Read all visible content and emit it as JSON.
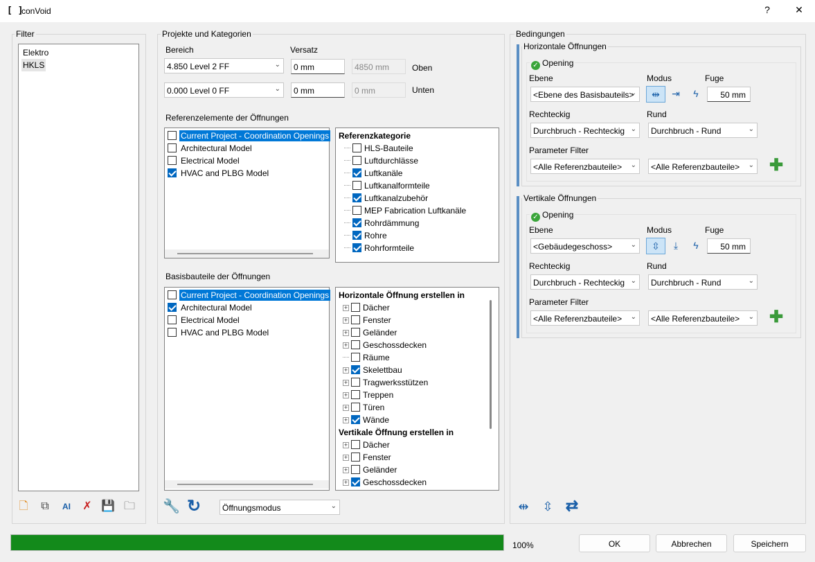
{
  "window": {
    "icon": "[ ]",
    "title": "conVoid",
    "help": "?",
    "close": "✕"
  },
  "filter": {
    "label": "Filter",
    "items": [
      "Elektro",
      "HKLS"
    ]
  },
  "projekte": {
    "label": "Projekte und Kategorien",
    "bereich_label": "Bereich",
    "versatz_label": "Versatz",
    "oben": {
      "level": "4.850  Level 2 FF",
      "offset": "0 mm",
      "computed": "4850 mm",
      "label": "Oben"
    },
    "unten": {
      "level": "0.000  Level 0 FF",
      "offset": "0 mm",
      "computed": "0 mm",
      "label": "Unten"
    },
    "ref_label": "Referenzelemente der Öffnungen",
    "ref_models": [
      {
        "label": "Current Project - Coordination Openings",
        "checked": false,
        "selected": true
      },
      {
        "label": "Architectural Model",
        "checked": false,
        "selected": false
      },
      {
        "label": "Electrical Model",
        "checked": false,
        "selected": false
      },
      {
        "label": "HVAC and PLBG Model",
        "checked": true,
        "selected": false
      }
    ],
    "ref_cat_header": "Referenzkategorie",
    "ref_cats": [
      {
        "label": "HLS-Bauteile",
        "checked": false
      },
      {
        "label": "Luftdurchlässe",
        "checked": false
      },
      {
        "label": "Luftkanäle",
        "checked": true
      },
      {
        "label": "Luftkanalformteile",
        "checked": false
      },
      {
        "label": "Luftkanalzubehör",
        "checked": true
      },
      {
        "label": "MEP Fabrication Luftkanäle",
        "checked": false
      },
      {
        "label": "Rohrdämmung",
        "checked": true
      },
      {
        "label": "Rohre",
        "checked": true
      },
      {
        "label": "Rohrformteile",
        "checked": true
      }
    ],
    "basis_label": "Basisbauteile der Öffnungen",
    "basis_models": [
      {
        "label": "Current Project - Coordination Openings",
        "checked": false,
        "selected": true
      },
      {
        "label": "Architectural Model",
        "checked": true,
        "selected": false
      },
      {
        "label": "Electrical Model",
        "checked": false,
        "selected": false
      },
      {
        "label": "HVAC and PLBG Model",
        "checked": false,
        "selected": false
      }
    ],
    "h_header": "Horizontale Öffnung erstellen in",
    "h_cats": [
      {
        "label": "Dächer",
        "checked": false,
        "plus": true
      },
      {
        "label": "Fenster",
        "checked": false,
        "plus": true
      },
      {
        "label": "Geländer",
        "checked": false,
        "plus": true
      },
      {
        "label": "Geschossdecken",
        "checked": false,
        "plus": true
      },
      {
        "label": "Räume",
        "checked": false,
        "plus": false
      },
      {
        "label": "Skelettbau",
        "checked": true,
        "plus": true
      },
      {
        "label": "Tragwerksstützen",
        "checked": false,
        "plus": true
      },
      {
        "label": "Treppen",
        "checked": false,
        "plus": true
      },
      {
        "label": "Türen",
        "checked": false,
        "plus": true
      },
      {
        "label": "Wände",
        "checked": true,
        "plus": true
      }
    ],
    "v_header": "Vertikale Öffnung erstellen in",
    "v_cats": [
      {
        "label": "Dächer",
        "checked": false,
        "plus": true
      },
      {
        "label": "Fenster",
        "checked": false,
        "plus": true
      },
      {
        "label": "Geländer",
        "checked": false,
        "plus": true
      },
      {
        "label": "Geschossdecken",
        "checked": true,
        "plus": true
      }
    ],
    "mode_select": "Öffnungsmodus"
  },
  "bedingungen": {
    "label": "Bedingungen",
    "horizontal": {
      "label": "Horizontale Öffnungen",
      "opening": "Opening",
      "ebene_label": "Ebene",
      "modus_label": "Modus",
      "fuge_label": "Fuge",
      "ebene": "<Ebene des Basisbauteils>",
      "fuge": "50 mm",
      "rechteckig_label": "Rechteckig",
      "rund_label": "Rund",
      "rechteckig": "Durchbruch - Rechteckig",
      "rund": "Durchbruch - Rund",
      "param_label": "Parameter Filter",
      "param1": "<Alle Referenzbauteile>",
      "param2": "<Alle Referenzbauteile>"
    },
    "vertikal": {
      "label": "Vertikale Öffnungen",
      "opening": "Opening",
      "ebene_label": "Ebene",
      "modus_label": "Modus",
      "fuge_label": "Fuge",
      "ebene": "<Gebäudegeschoss>",
      "fuge": "50 mm",
      "rechteckig_label": "Rechteckig",
      "rund_label": "Rund",
      "rechteckig": "Durchbruch - Rechteckig",
      "rund": "Durchbruch - Rund",
      "param_label": "Parameter Filter",
      "param1": "<Alle Referenzbauteile>",
      "param2": "<Alle Referenzbauteile>"
    }
  },
  "footer": {
    "progress": 100,
    "progress_text": "100%",
    "ok": "OK",
    "cancel": "Abbrechen",
    "save": "Speichern"
  }
}
